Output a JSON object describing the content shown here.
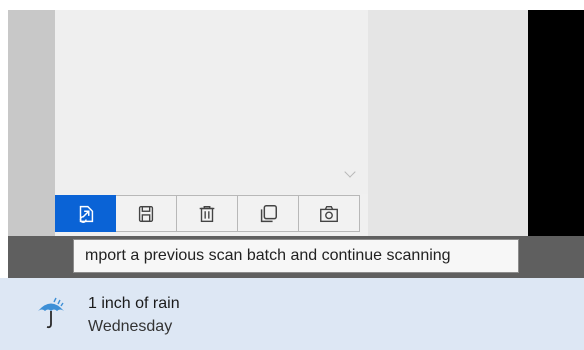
{
  "toolbar": {
    "buttons": [
      {
        "icon": "import-icon",
        "active": true
      },
      {
        "icon": "save-icon",
        "active": false
      },
      {
        "icon": "trash-icon",
        "active": false
      },
      {
        "icon": "copy-icon",
        "active": false
      },
      {
        "icon": "camera-icon",
        "active": false
      }
    ]
  },
  "tooltip": {
    "text": "mport a previous scan batch and continue scanning"
  },
  "weather": {
    "title": "1 inch of rain",
    "subtitle": "Wednesday",
    "icon": "umbrella-rain-icon"
  },
  "colors": {
    "accent": "#0a63d6",
    "weather_bg": "#dde7f4"
  }
}
